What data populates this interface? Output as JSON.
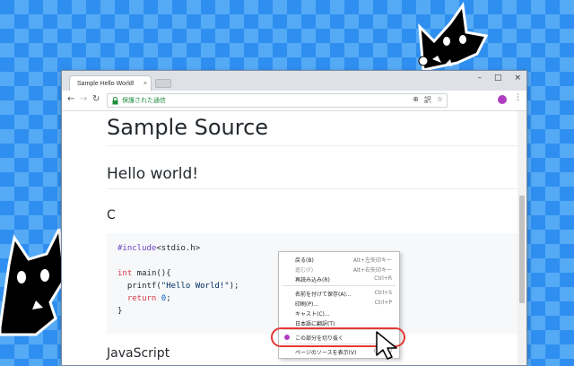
{
  "browser": {
    "tab_title": "Sample Hello World!",
    "tab_close": "×",
    "window_buttons": [
      "–",
      "□",
      "×"
    ],
    "nav": {
      "back": "←",
      "forward": "→",
      "reload": "↻"
    },
    "address": {
      "secure_label": "保護された通信",
      "lock": "🔒"
    },
    "omnibox_icons": [
      "⊕",
      "訳",
      "☆"
    ],
    "menu": "⋮"
  },
  "page": {
    "h1": "Sample Source",
    "h2": "Hello world!",
    "h3_c": "C",
    "code_lines": [
      {
        "parts": [
          {
            "c": "pp",
            "t": "#include"
          },
          {
            "c": "",
            "t": "<stdio.h>"
          }
        ]
      },
      {
        "parts": []
      },
      {
        "parts": [
          {
            "c": "kw",
            "t": "int"
          },
          {
            "c": "",
            "t": " main(){"
          }
        ]
      },
      {
        "parts": [
          {
            "c": "",
            "t": "  printf("
          },
          {
            "c": "str",
            "t": "\"Hello World!\""
          },
          {
            "c": "",
            "t": ");"
          }
        ]
      },
      {
        "parts": [
          {
            "c": "",
            "t": "  "
          },
          {
            "c": "kw",
            "t": "return"
          },
          {
            "c": "",
            "t": " "
          },
          {
            "c": "num",
            "t": "0"
          },
          {
            "c": "",
            "t": ";"
          }
        ]
      },
      {
        "parts": [
          {
            "c": "",
            "t": "}"
          }
        ]
      }
    ],
    "h3_js": "JavaScript"
  },
  "context_menu": {
    "items": [
      {
        "label": "戻る(B)",
        "shortcut": "Alt+左矢印キー",
        "disabled": false
      },
      {
        "label": "進む(F)",
        "shortcut": "Alt+右矢印キー",
        "disabled": true
      },
      {
        "label": "再読み込み(R)",
        "shortcut": "Ctrl+R",
        "disabled": false
      },
      {
        "sep": true
      },
      {
        "label": "名前を付けて保存(A)...",
        "shortcut": "Ctrl+S",
        "disabled": false
      },
      {
        "label": "印刷(P)...",
        "shortcut": "Ctrl+P",
        "disabled": false
      },
      {
        "label": "キャスト(C)...",
        "shortcut": "",
        "disabled": false
      },
      {
        "label": "日本語に翻訳(T)",
        "shortcut": "",
        "disabled": false
      },
      {
        "sep": true
      },
      {
        "label": "この部分を切り抜く",
        "shortcut": "",
        "disabled": false,
        "icon": true
      },
      {
        "sep": true
      },
      {
        "label": "ページのソースを表示(V)",
        "shortcut": "Ctrl+U",
        "disabled": false
      }
    ]
  },
  "colors": {
    "background": "#2f8ff0",
    "accent": "#e53935",
    "extension": "#b03ec0"
  }
}
